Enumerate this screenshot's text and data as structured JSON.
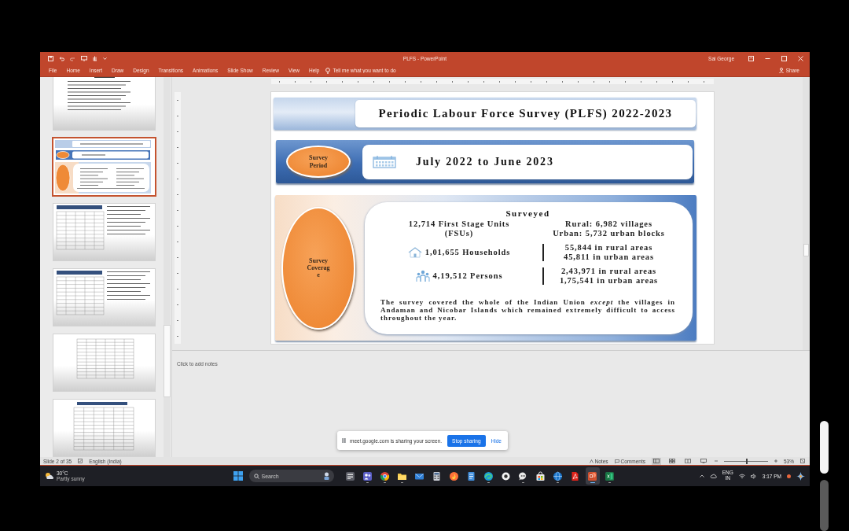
{
  "title_bar": {
    "title": "PLFS - PowerPoint",
    "user": "Sai George"
  },
  "ribbon_tabs": [
    "File",
    "Home",
    "Insert",
    "Draw",
    "Design",
    "Transitions",
    "Animations",
    "Slide Show",
    "Review",
    "View",
    "Help"
  ],
  "tell_me": {
    "placeholder": "Tell me what you want to do"
  },
  "share_button": "Share",
  "slides": [
    {
      "kind": "bullets",
      "selected": false
    },
    {
      "kind": "summary",
      "selected": true
    },
    {
      "kind": "table-text",
      "selected": false
    },
    {
      "kind": "table-text",
      "selected": false
    },
    {
      "kind": "table",
      "selected": false
    },
    {
      "kind": "table-titled",
      "selected": false
    }
  ],
  "slide": {
    "title": "Periodic Labour Force Survey (PLFS) 2022-2023",
    "period": {
      "label": "Survey Period",
      "value": "July 2022 to June 2023"
    },
    "coverage": {
      "label": "Survey Coverage",
      "heading": "Surveyed",
      "rows": [
        {
          "kind": "units",
          "left": "12,714 First Stage Units (FSUs)",
          "right": [
            "Rural: 6,982 villages",
            "Urban: 5,732 urban blocks"
          ]
        },
        {
          "kind": "households",
          "left": "1,01,655 Households",
          "right": [
            "55,844 in rural areas",
            "45,811 in urban areas"
          ]
        },
        {
          "kind": "persons",
          "left": "4,19,512 Persons",
          "right": [
            "2,43,971 in rural areas",
            "1,75,541 in urban areas"
          ]
        }
      ],
      "note": "The survey covered the whole of the Indian Union *except* the villages in Andaman and Nicobar Islands which remained extremely difficult to access throughout the year."
    }
  },
  "notes": {
    "placeholder": "Click to add notes"
  },
  "share_notice": {
    "message": "meet.google.com is sharing your screen.",
    "stop_button": "Stop sharing",
    "hide_button": "Hide"
  },
  "status_bar": {
    "slide_counter": "Slide 2 of 35",
    "language": "English (India)",
    "notes_button": "Notes",
    "comments_button": "Comments",
    "views": [
      {
        "kind": "normal",
        "selected": true
      },
      {
        "kind": "sorter",
        "selected": false
      },
      {
        "kind": "reading",
        "selected": false
      },
      {
        "kind": "slideshow",
        "selected": false
      }
    ],
    "zoom": {
      "level": 0.5,
      "reading": "53%"
    }
  },
  "taskbar": {
    "weather": {
      "temperature": "30°C",
      "condition": "Partly sunny"
    },
    "search": {
      "placeholder": "Search"
    },
    "apps": [
      {
        "kind": "panel",
        "open": false,
        "selected": false
      },
      {
        "kind": "people",
        "open": true,
        "selected": false
      },
      {
        "kind": "ring",
        "open": true,
        "selected": false
      },
      {
        "kind": "folder",
        "open": true,
        "selected": false
      },
      {
        "kind": "envelope",
        "open": false,
        "selected": false
      },
      {
        "kind": "calculator",
        "open": false,
        "selected": false
      },
      {
        "kind": "flame",
        "open": false,
        "selected": false
      },
      {
        "kind": "notepad",
        "open": false,
        "selected": false
      },
      {
        "kind": "wave",
        "open": true,
        "selected": false
      },
      {
        "kind": "dot",
        "open": false,
        "selected": false
      },
      {
        "kind": "chat",
        "open": true,
        "selected": false
      },
      {
        "kind": "bag",
        "open": false,
        "selected": false
      },
      {
        "kind": "globe",
        "open": true,
        "selected": false
      },
      {
        "kind": "document",
        "open": false,
        "selected": false
      },
      {
        "kind": "presentation",
        "open": true,
        "selected": true
      },
      {
        "kind": "spreadsheet",
        "open": true,
        "selected": false
      }
    ],
    "language": [
      "ENG",
      "IN"
    ],
    "time": "3:17 PM"
  }
}
